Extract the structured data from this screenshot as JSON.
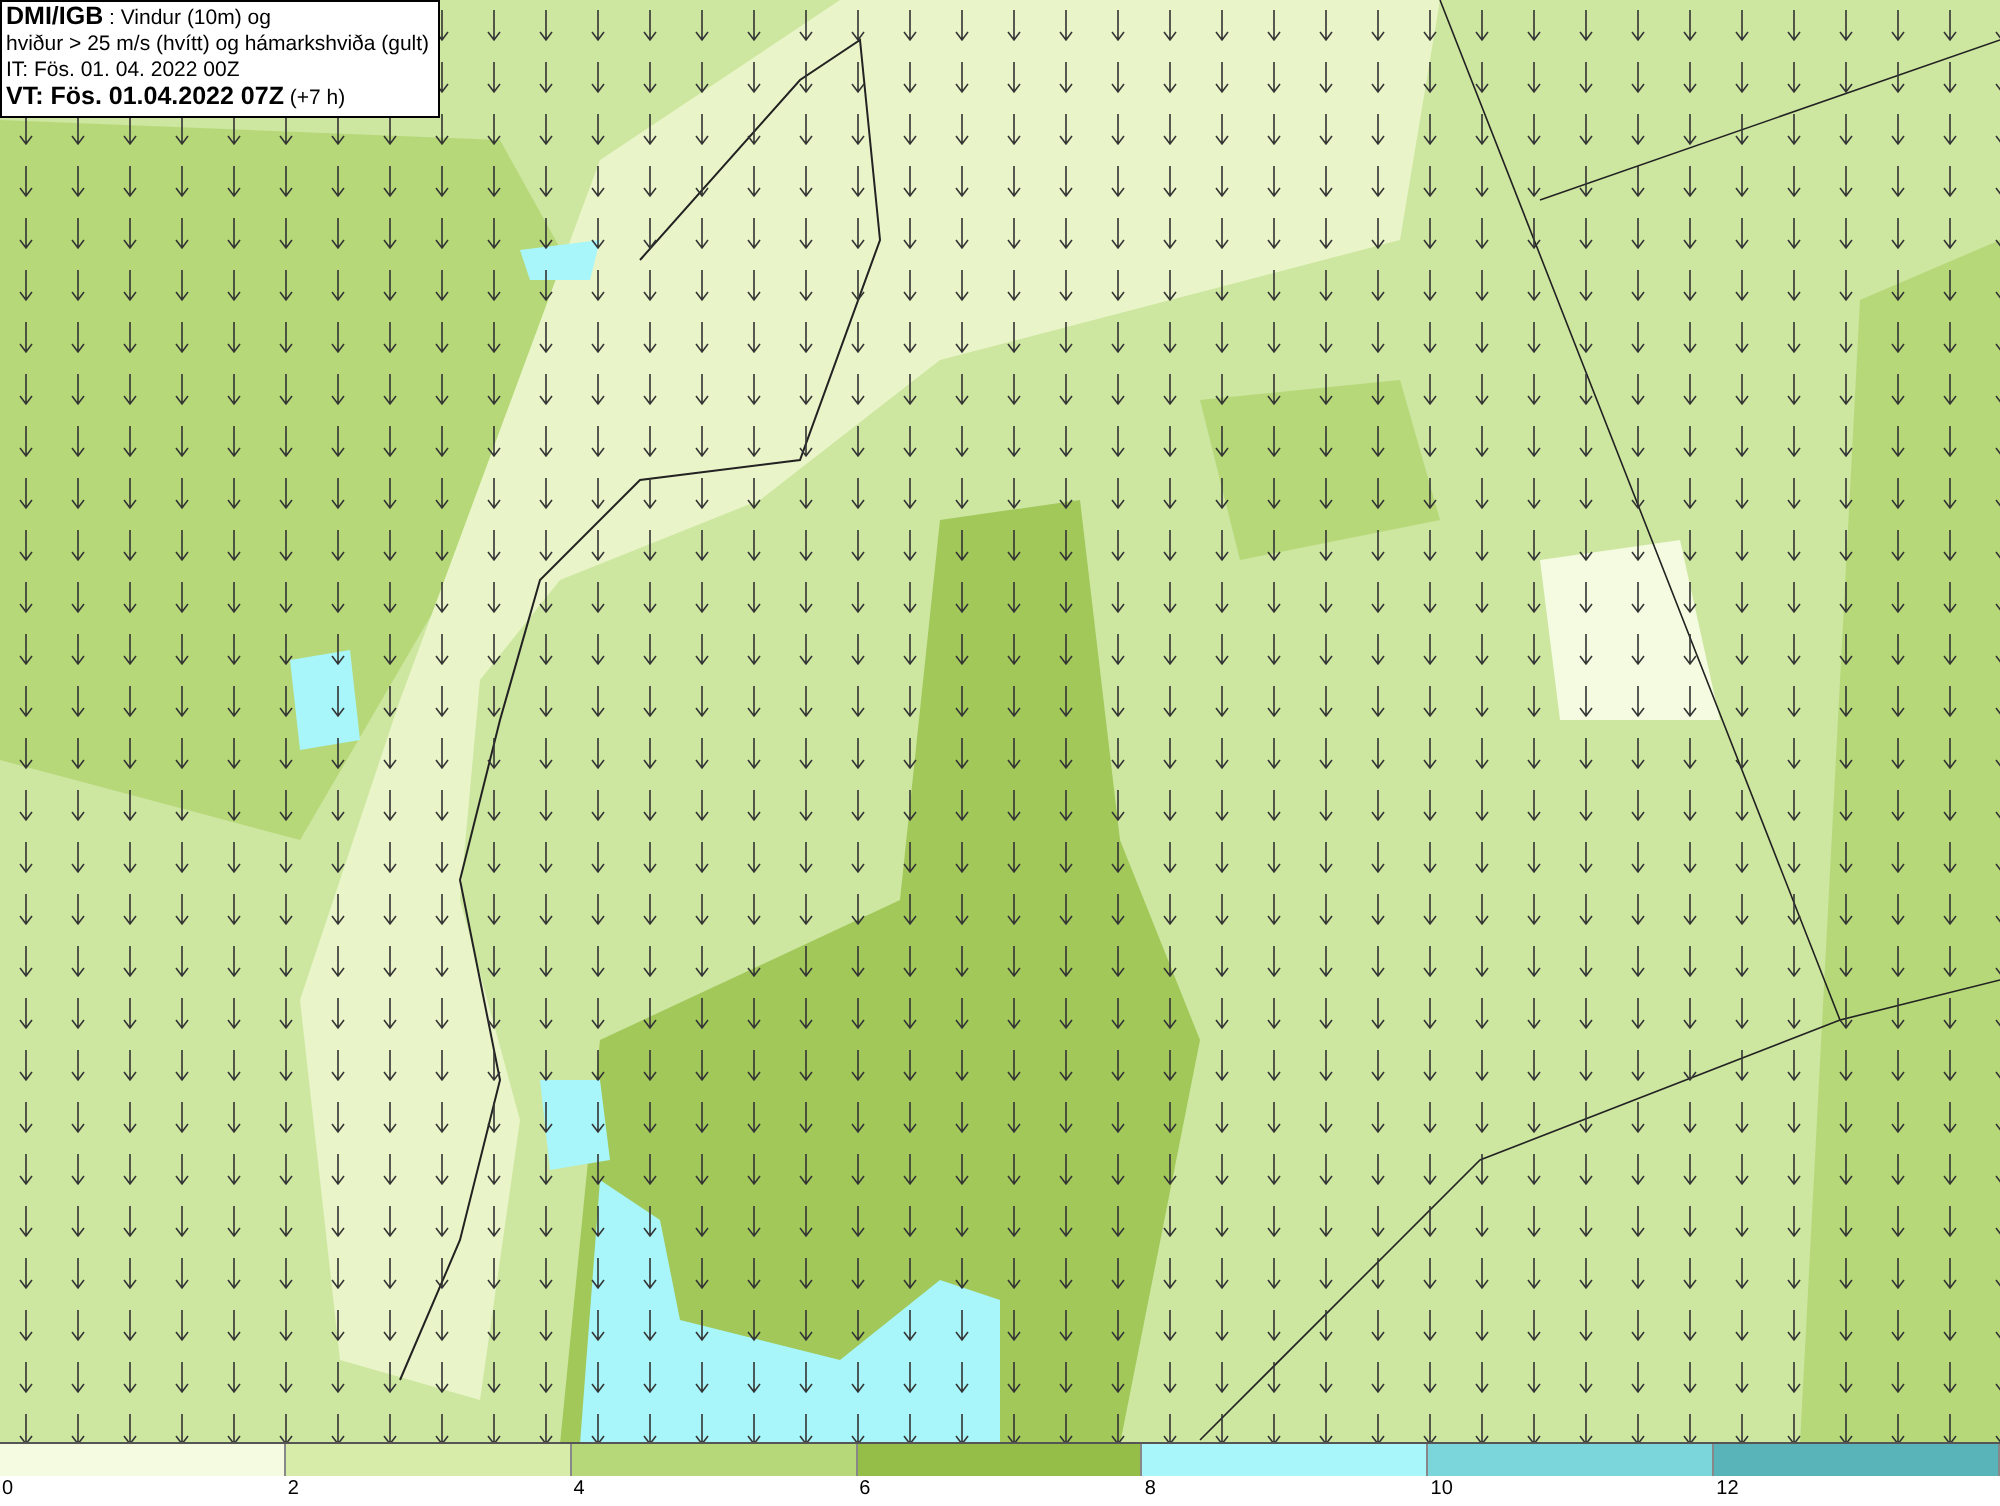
{
  "header": {
    "lines": [
      "**DMI/IGB** : Vindur (10m) og",
      "hviður > 25 m/s (hvítt) og hámarkshviða (gult)",
      "IT: Fös. 01. 04. 2022 00Z",
      "**VT: Fös. 01.04.2022 07Z** (+7 h)"
    ]
  },
  "legend": {
    "segments": [
      {
        "label": "0",
        "color": "#f4fbe0"
      },
      {
        "label": "2",
        "color": "#d6eca8"
      },
      {
        "label": "4",
        "color": "#b6d878"
      },
      {
        "label": "6",
        "color": "#94be48"
      },
      {
        "label": "8",
        "color": "#a8f6fa"
      },
      {
        "label": "10",
        "color": "#7ad6da"
      },
      {
        "label": "12",
        "color": "#58b4b8"
      }
    ]
  }
}
